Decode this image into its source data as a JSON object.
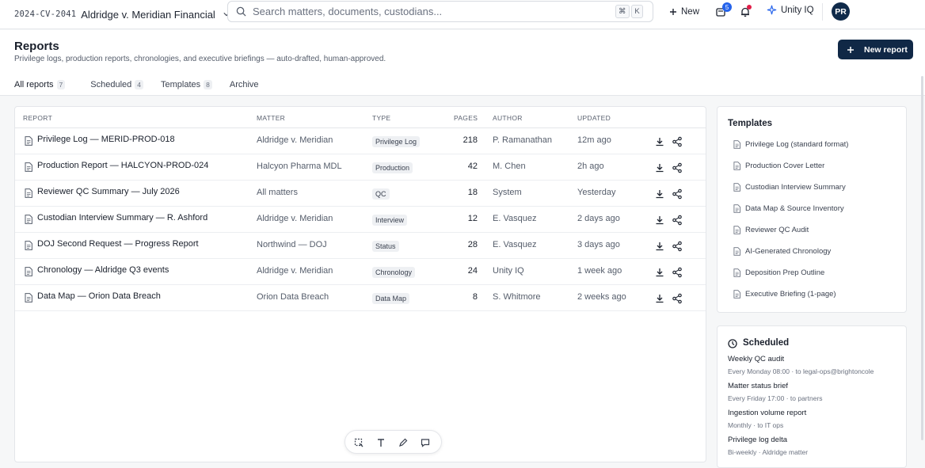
{
  "topbar": {
    "matter_code": "2024-CV-2041",
    "matter_name": "Aldridge v. Meridian Financial",
    "search_placeholder": "Search matters, documents, custodians...",
    "shortcut_key1": "⌘",
    "shortcut_key2": "K",
    "new_label": "New",
    "notifications_count": "5",
    "assistant_label": "Unity IQ",
    "avatar_initials": "PR"
  },
  "header": {
    "title": "Reports",
    "subtitle": "Privilege logs, production reports, chronologies, and executive briefings — auto-drafted, human-approved.",
    "new_report_label": "New report",
    "tabs": [
      {
        "label": "All reports",
        "count": "7"
      },
      {
        "label": "Scheduled",
        "count": "4"
      },
      {
        "label": "Templates",
        "count": "8"
      },
      {
        "label": "Archive",
        "count": ""
      }
    ]
  },
  "table": {
    "columns": [
      "REPORT",
      "MATTER",
      "TYPE",
      "PAGES",
      "AUTHOR",
      "UPDATED"
    ],
    "rows": [
      {
        "title": "Privilege Log — MERID-PROD-018",
        "matter": "Aldridge v. Meridian",
        "type": "Privilege Log",
        "pages": "218",
        "author": "P. Ramanathan",
        "updated": "12m ago"
      },
      {
        "title": "Production Report — HALCYON-PROD-024",
        "matter": "Halcyon Pharma MDL",
        "type": "Production",
        "pages": "42",
        "author": "M. Chen",
        "updated": "2h ago"
      },
      {
        "title": "Reviewer QC Summary — July 2026",
        "matter": "All matters",
        "type": "QC",
        "pages": "18",
        "author": "System",
        "updated": "Yesterday"
      },
      {
        "title": "Custodian Interview Summary — R. Ashford",
        "matter": "Aldridge v. Meridian",
        "type": "Interview",
        "pages": "12",
        "author": "E. Vasquez",
        "updated": "2 days ago"
      },
      {
        "title": "DOJ Second Request — Progress Report",
        "matter": "Northwind — DOJ",
        "type": "Status",
        "pages": "28",
        "author": "E. Vasquez",
        "updated": "3 days ago"
      },
      {
        "title": "Chronology — Aldridge Q3 events",
        "matter": "Aldridge v. Meridian",
        "type": "Chronology",
        "pages": "24",
        "author": "Unity IQ",
        "updated": "1 week ago"
      },
      {
        "title": "Data Map — Orion Data Breach",
        "matter": "Orion Data Breach",
        "type": "Data Map",
        "pages": "8",
        "author": "S. Whitmore",
        "updated": "2 weeks ago"
      }
    ]
  },
  "templates": {
    "title": "Templates",
    "items": [
      "Privilege Log (standard format)",
      "Production Cover Letter",
      "Custodian Interview Summary",
      "Data Map & Source Inventory",
      "Reviewer QC Audit",
      "AI-Generated Chronology",
      "Deposition Prep Outline",
      "Executive Briefing (1-page)"
    ]
  },
  "scheduled": {
    "title": "Scheduled",
    "items": [
      {
        "name": "Weekly QC audit",
        "detail": "Every Monday 08:00 · to legal-ops@brightoncole"
      },
      {
        "name": "Matter status brief",
        "detail": "Every Friday 17:00 · to partners"
      },
      {
        "name": "Ingestion volume report",
        "detail": "Monthly · to IT ops"
      },
      {
        "name": "Privilege log delta",
        "detail": "Bi-weekly · Aldridge matter"
      }
    ]
  },
  "colors": {
    "primary": "#102846",
    "badge": "#2563eb",
    "alert": "#e11d48"
  }
}
